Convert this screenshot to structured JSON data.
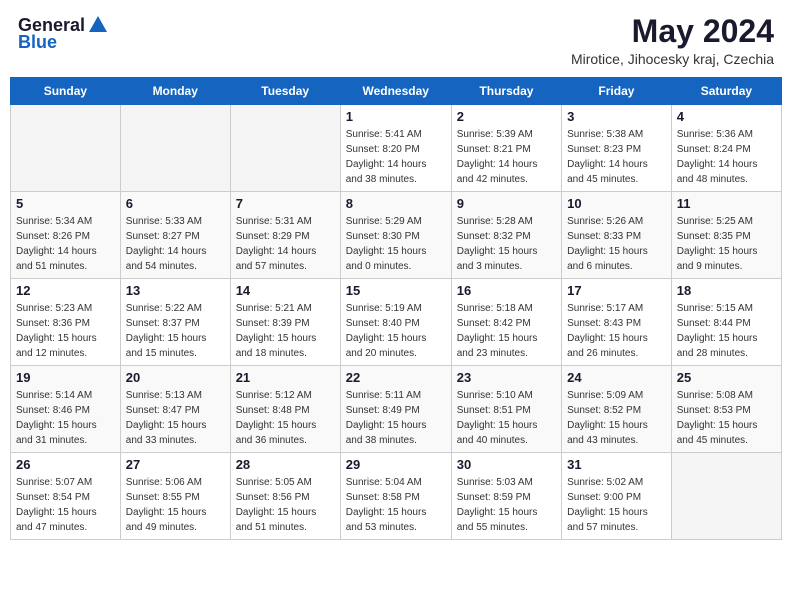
{
  "header": {
    "logo_general": "General",
    "logo_blue": "Blue",
    "month": "May 2024",
    "location": "Mirotice, Jihocesky kraj, Czechia"
  },
  "days_of_week": [
    "Sunday",
    "Monday",
    "Tuesday",
    "Wednesday",
    "Thursday",
    "Friday",
    "Saturday"
  ],
  "weeks": [
    [
      {
        "day": "",
        "info": ""
      },
      {
        "day": "",
        "info": ""
      },
      {
        "day": "",
        "info": ""
      },
      {
        "day": "1",
        "info": "Sunrise: 5:41 AM\nSunset: 8:20 PM\nDaylight: 14 hours\nand 38 minutes."
      },
      {
        "day": "2",
        "info": "Sunrise: 5:39 AM\nSunset: 8:21 PM\nDaylight: 14 hours\nand 42 minutes."
      },
      {
        "day": "3",
        "info": "Sunrise: 5:38 AM\nSunset: 8:23 PM\nDaylight: 14 hours\nand 45 minutes."
      },
      {
        "day": "4",
        "info": "Sunrise: 5:36 AM\nSunset: 8:24 PM\nDaylight: 14 hours\nand 48 minutes."
      }
    ],
    [
      {
        "day": "5",
        "info": "Sunrise: 5:34 AM\nSunset: 8:26 PM\nDaylight: 14 hours\nand 51 minutes."
      },
      {
        "day": "6",
        "info": "Sunrise: 5:33 AM\nSunset: 8:27 PM\nDaylight: 14 hours\nand 54 minutes."
      },
      {
        "day": "7",
        "info": "Sunrise: 5:31 AM\nSunset: 8:29 PM\nDaylight: 14 hours\nand 57 minutes."
      },
      {
        "day": "8",
        "info": "Sunrise: 5:29 AM\nSunset: 8:30 PM\nDaylight: 15 hours\nand 0 minutes."
      },
      {
        "day": "9",
        "info": "Sunrise: 5:28 AM\nSunset: 8:32 PM\nDaylight: 15 hours\nand 3 minutes."
      },
      {
        "day": "10",
        "info": "Sunrise: 5:26 AM\nSunset: 8:33 PM\nDaylight: 15 hours\nand 6 minutes."
      },
      {
        "day": "11",
        "info": "Sunrise: 5:25 AM\nSunset: 8:35 PM\nDaylight: 15 hours\nand 9 minutes."
      }
    ],
    [
      {
        "day": "12",
        "info": "Sunrise: 5:23 AM\nSunset: 8:36 PM\nDaylight: 15 hours\nand 12 minutes."
      },
      {
        "day": "13",
        "info": "Sunrise: 5:22 AM\nSunset: 8:37 PM\nDaylight: 15 hours\nand 15 minutes."
      },
      {
        "day": "14",
        "info": "Sunrise: 5:21 AM\nSunset: 8:39 PM\nDaylight: 15 hours\nand 18 minutes."
      },
      {
        "day": "15",
        "info": "Sunrise: 5:19 AM\nSunset: 8:40 PM\nDaylight: 15 hours\nand 20 minutes."
      },
      {
        "day": "16",
        "info": "Sunrise: 5:18 AM\nSunset: 8:42 PM\nDaylight: 15 hours\nand 23 minutes."
      },
      {
        "day": "17",
        "info": "Sunrise: 5:17 AM\nSunset: 8:43 PM\nDaylight: 15 hours\nand 26 minutes."
      },
      {
        "day": "18",
        "info": "Sunrise: 5:15 AM\nSunset: 8:44 PM\nDaylight: 15 hours\nand 28 minutes."
      }
    ],
    [
      {
        "day": "19",
        "info": "Sunrise: 5:14 AM\nSunset: 8:46 PM\nDaylight: 15 hours\nand 31 minutes."
      },
      {
        "day": "20",
        "info": "Sunrise: 5:13 AM\nSunset: 8:47 PM\nDaylight: 15 hours\nand 33 minutes."
      },
      {
        "day": "21",
        "info": "Sunrise: 5:12 AM\nSunset: 8:48 PM\nDaylight: 15 hours\nand 36 minutes."
      },
      {
        "day": "22",
        "info": "Sunrise: 5:11 AM\nSunset: 8:49 PM\nDaylight: 15 hours\nand 38 minutes."
      },
      {
        "day": "23",
        "info": "Sunrise: 5:10 AM\nSunset: 8:51 PM\nDaylight: 15 hours\nand 40 minutes."
      },
      {
        "day": "24",
        "info": "Sunrise: 5:09 AM\nSunset: 8:52 PM\nDaylight: 15 hours\nand 43 minutes."
      },
      {
        "day": "25",
        "info": "Sunrise: 5:08 AM\nSunset: 8:53 PM\nDaylight: 15 hours\nand 45 minutes."
      }
    ],
    [
      {
        "day": "26",
        "info": "Sunrise: 5:07 AM\nSunset: 8:54 PM\nDaylight: 15 hours\nand 47 minutes."
      },
      {
        "day": "27",
        "info": "Sunrise: 5:06 AM\nSunset: 8:55 PM\nDaylight: 15 hours\nand 49 minutes."
      },
      {
        "day": "28",
        "info": "Sunrise: 5:05 AM\nSunset: 8:56 PM\nDaylight: 15 hours\nand 51 minutes."
      },
      {
        "day": "29",
        "info": "Sunrise: 5:04 AM\nSunset: 8:58 PM\nDaylight: 15 hours\nand 53 minutes."
      },
      {
        "day": "30",
        "info": "Sunrise: 5:03 AM\nSunset: 8:59 PM\nDaylight: 15 hours\nand 55 minutes."
      },
      {
        "day": "31",
        "info": "Sunrise: 5:02 AM\nSunset: 9:00 PM\nDaylight: 15 hours\nand 57 minutes."
      },
      {
        "day": "",
        "info": ""
      }
    ]
  ]
}
